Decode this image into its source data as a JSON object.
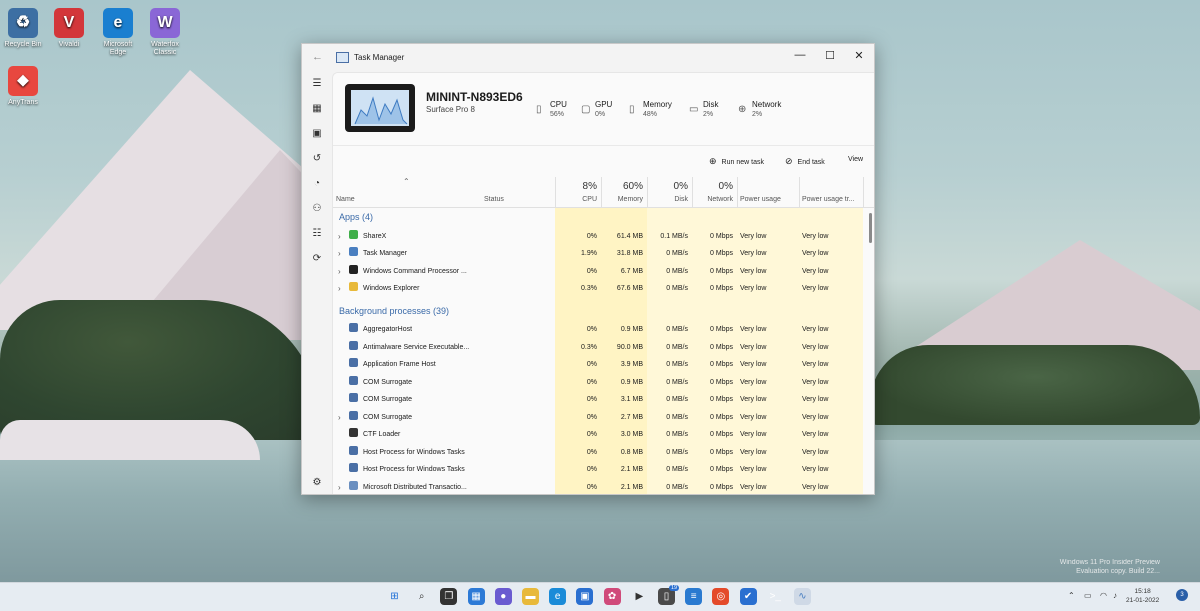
{
  "desktop": {
    "icons": [
      {
        "label": "Recycle Bin",
        "glyph": "♻",
        "color": "#3d6fa3"
      },
      {
        "label": "Vivaldi",
        "glyph": "V",
        "color": "#d3363a"
      },
      {
        "label": "Microsoft Edge",
        "glyph": "e",
        "color": "#1a7fd0"
      },
      {
        "label": "Waterfox Classic",
        "glyph": "W",
        "color": "#8a67d6"
      },
      {
        "label": "AnyTrans",
        "glyph": "⬥",
        "color": "#e8473f"
      }
    ],
    "watermark_line1": "Windows 11 Pro Insider Preview",
    "watermark_line2": "Evaluation copy. Build 22..."
  },
  "window": {
    "title": "Task Manager",
    "device_name": "MININT-N893ED6",
    "device_model": "Surface Pro 8",
    "stats": [
      {
        "label": "CPU",
        "value": "56%",
        "icon": "cpu-icon"
      },
      {
        "label": "GPU",
        "value": "0%",
        "icon": "gpu-icon"
      },
      {
        "label": "Memory",
        "value": "48%",
        "icon": "memory-icon"
      },
      {
        "label": "Disk",
        "value": "2%",
        "icon": "disk-icon"
      },
      {
        "label": "Network",
        "value": "2%",
        "icon": "network-icon"
      }
    ],
    "toolbar": {
      "run_new_task": "Run new task",
      "end_task": "End task",
      "view": "View"
    }
  },
  "table": {
    "columns": {
      "name": "Name",
      "status": "Status",
      "cpu_pct": "8%",
      "cpu": "CPU",
      "memory_pct": "60%",
      "memory": "Memory",
      "disk_pct": "0%",
      "disk": "Disk",
      "network_pct": "0%",
      "network": "Network",
      "power": "Power usage",
      "power_trend": "Power usage tr..."
    },
    "apps_group": "Apps (4)",
    "apps": [
      {
        "name": "ShareX",
        "cpu": "0%",
        "memory": "61.4 MB",
        "disk": "0.1 MB/s",
        "network": "0 Mbps",
        "power": "Very low",
        "trend": "Very low",
        "expand": true,
        "icon_color": "#3fae49"
      },
      {
        "name": "Task Manager",
        "cpu": "1.9%",
        "memory": "31.8 MB",
        "disk": "0 MB/s",
        "network": "0 Mbps",
        "power": "Very low",
        "trend": "Very low",
        "expand": true,
        "icon_color": "#4a7fc0"
      },
      {
        "name": "Windows Command Processor ...",
        "cpu": "0%",
        "memory": "6.7 MB",
        "disk": "0 MB/s",
        "network": "0 Mbps",
        "power": "Very low",
        "trend": "Very low",
        "expand": true,
        "icon_color": "#222222"
      },
      {
        "name": "Windows Explorer",
        "cpu": "0.3%",
        "memory": "67.6 MB",
        "disk": "0 MB/s",
        "network": "0 Mbps",
        "power": "Very low",
        "trend": "Very low",
        "expand": true,
        "icon_color": "#e8b93a"
      }
    ],
    "bg_group": "Background processes (39)",
    "background": [
      {
        "name": "AggregatorHost",
        "cpu": "0%",
        "memory": "0.9 MB",
        "disk": "0 MB/s",
        "network": "0 Mbps",
        "power": "Very low",
        "trend": "Very low",
        "expand": false,
        "icon_color": "#4a6fa5"
      },
      {
        "name": "Antimalware Service Executable...",
        "cpu": "0.3%",
        "memory": "90.0 MB",
        "disk": "0 MB/s",
        "network": "0 Mbps",
        "power": "Very low",
        "trend": "Very low",
        "expand": false,
        "icon_color": "#4a6fa5"
      },
      {
        "name": "Application Frame Host",
        "cpu": "0%",
        "memory": "3.9 MB",
        "disk": "0 MB/s",
        "network": "0 Mbps",
        "power": "Very low",
        "trend": "Very low",
        "expand": false,
        "icon_color": "#4a6fa5"
      },
      {
        "name": "COM Surrogate",
        "cpu": "0%",
        "memory": "0.9 MB",
        "disk": "0 MB/s",
        "network": "0 Mbps",
        "power": "Very low",
        "trend": "Very low",
        "expand": false,
        "icon_color": "#4a6fa5"
      },
      {
        "name": "COM Surrogate",
        "cpu": "0%",
        "memory": "3.1 MB",
        "disk": "0 MB/s",
        "network": "0 Mbps",
        "power": "Very low",
        "trend": "Very low",
        "expand": false,
        "icon_color": "#4a6fa5"
      },
      {
        "name": "COM Surrogate",
        "cpu": "0%",
        "memory": "2.7 MB",
        "disk": "0 MB/s",
        "network": "0 Mbps",
        "power": "Very low",
        "trend": "Very low",
        "expand": true,
        "icon_color": "#4a6fa5"
      },
      {
        "name": "CTF Loader",
        "cpu": "0%",
        "memory": "3.0 MB",
        "disk": "0 MB/s",
        "network": "0 Mbps",
        "power": "Very low",
        "trend": "Very low",
        "expand": false,
        "icon_color": "#333333"
      },
      {
        "name": "Host Process for Windows Tasks",
        "cpu": "0%",
        "memory": "0.8 MB",
        "disk": "0 MB/s",
        "network": "0 Mbps",
        "power": "Very low",
        "trend": "Very low",
        "expand": false,
        "icon_color": "#4a6fa5"
      },
      {
        "name": "Host Process for Windows Tasks",
        "cpu": "0%",
        "memory": "2.1 MB",
        "disk": "0 MB/s",
        "network": "0 Mbps",
        "power": "Very low",
        "trend": "Very low",
        "expand": false,
        "icon_color": "#4a6fa5"
      },
      {
        "name": "Microsoft Distributed Transactio...",
        "cpu": "0%",
        "memory": "2.1 MB",
        "disk": "0 MB/s",
        "network": "0 Mbps",
        "power": "Very low",
        "trend": "Very low",
        "expand": true,
        "icon_color": "#6a8fc0"
      }
    ]
  },
  "taskbar": {
    "apps": [
      {
        "name": "start-icon",
        "glyph": "⊞",
        "color": "#1f6fd6"
      },
      {
        "name": "search-icon",
        "glyph": "⌕",
        "color": "#333333"
      },
      {
        "name": "task-view-icon",
        "glyph": "❐",
        "color": "#333333"
      },
      {
        "name": "widgets-icon",
        "glyph": "▦",
        "color": "#2d7ad6"
      },
      {
        "name": "chat-icon",
        "glyph": "●",
        "color": "#6a5bd0"
      },
      {
        "name": "file-explorer-icon",
        "glyph": "▬",
        "color": "#e8b93a"
      },
      {
        "name": "edge-icon",
        "glyph": "e",
        "color": "#1a8bd8"
      },
      {
        "name": "store-icon",
        "glyph": "▣",
        "color": "#2a6fd0"
      },
      {
        "name": "photos-icon",
        "glyph": "✿",
        "color": "#d04a7a"
      },
      {
        "name": "media-player-icon",
        "glyph": "▶",
        "color": "#333333"
      },
      {
        "name": "phone-link-icon",
        "glyph": "▯",
        "color": "#4a4a4a"
      },
      {
        "name": "notepad-icon",
        "glyph": "≡",
        "color": "#2a7ad0"
      },
      {
        "name": "sharex-icon",
        "glyph": "◎",
        "color": "#e44a2a"
      },
      {
        "name": "todo-icon",
        "glyph": "✔",
        "color": "#2a6fd0"
      },
      {
        "name": "terminal-icon",
        "glyph": ">_",
        "color": "#1e1e1e"
      },
      {
        "name": "task-manager-icon",
        "glyph": "∿",
        "color": "#4a7fc0"
      }
    ],
    "badge": "19",
    "time": "15:18",
    "date": "21-01-2022",
    "notification_count": "3"
  }
}
